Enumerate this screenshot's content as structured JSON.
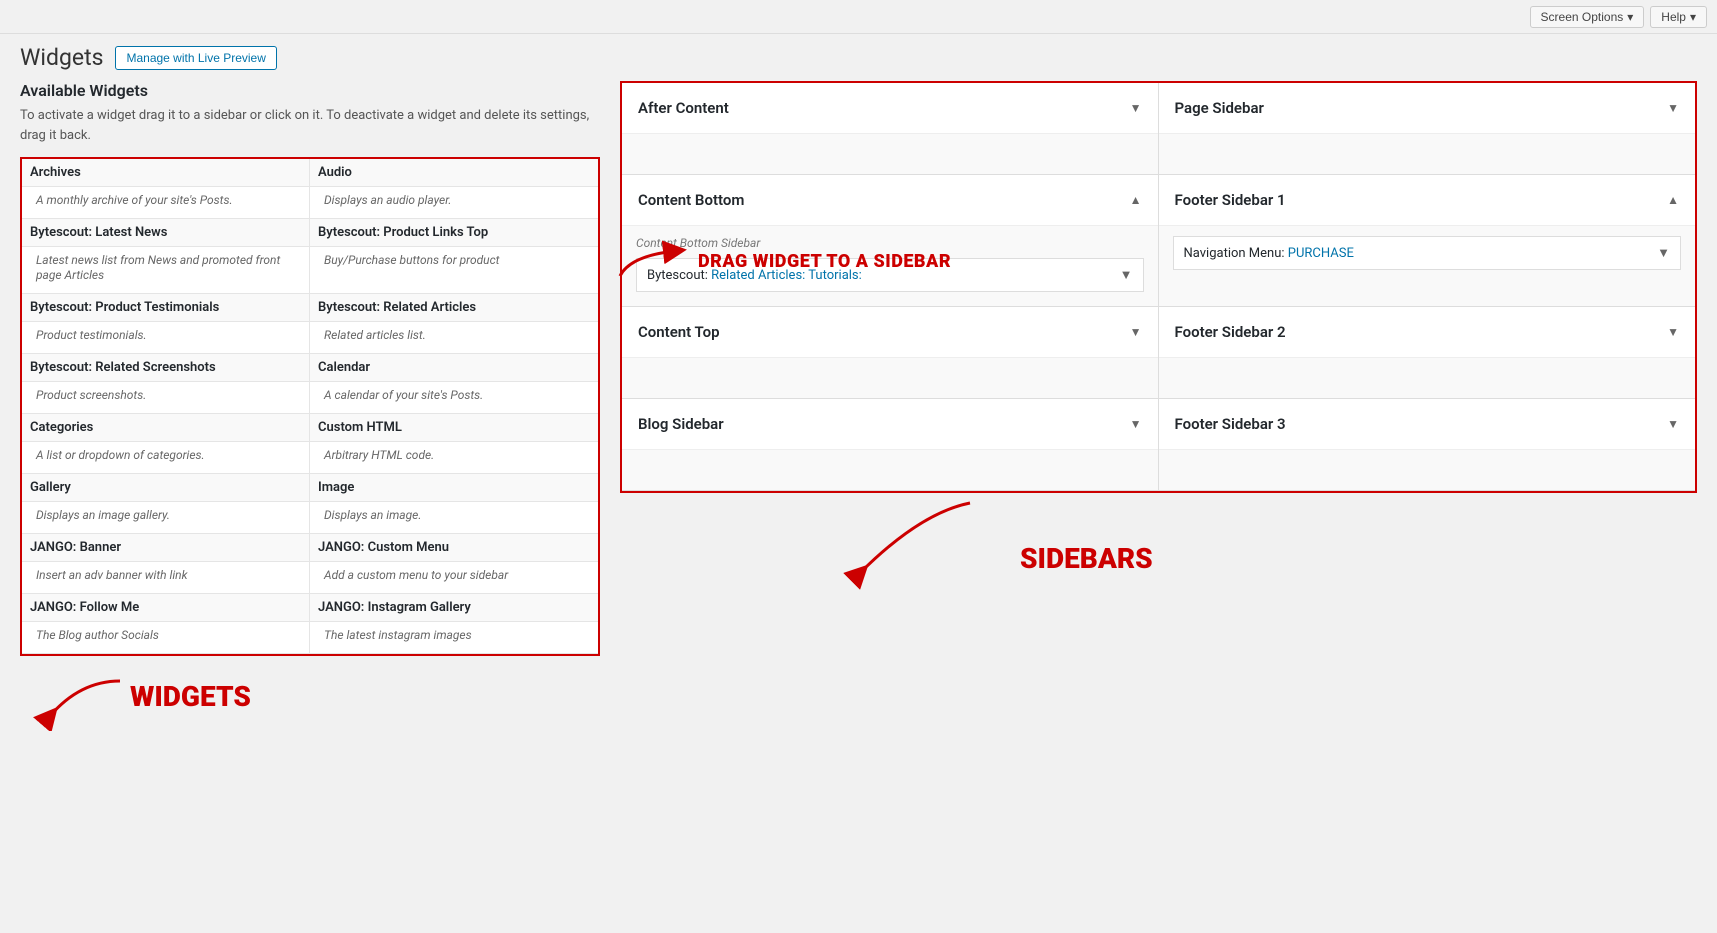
{
  "topbar": {
    "screen_options_label": "Screen Options",
    "help_label": "Help"
  },
  "header": {
    "title": "Widgets",
    "live_preview_label": "Manage with Live Preview"
  },
  "available_widgets": {
    "title": "Available Widgets",
    "description": "To activate a widget drag it to a sidebar or click on it. To deactivate a widget and delete its settings, drag it back."
  },
  "widgets": [
    {
      "name": "Archives",
      "desc": "A monthly archive of your site's Posts."
    },
    {
      "name": "Audio",
      "desc": "Displays an audio player."
    },
    {
      "name": "Bytescout: Latest News",
      "desc": "Latest news list from News and promoted front page Articles"
    },
    {
      "name": "Bytescout: Product Links Top",
      "desc": "Buy/Purchase buttons for product"
    },
    {
      "name": "Bytescout: Product Testimonials",
      "desc": "Product testimonials."
    },
    {
      "name": "Bytescout: Related Articles",
      "desc": "Related articles list."
    },
    {
      "name": "Bytescout: Related Screenshots",
      "desc": "Product screenshots."
    },
    {
      "name": "Calendar",
      "desc": "A calendar of your site's Posts."
    },
    {
      "name": "Categories",
      "desc": "A list or dropdown of categories."
    },
    {
      "name": "Custom HTML",
      "desc": "Arbitrary HTML code."
    },
    {
      "name": "Gallery",
      "desc": "Displays an image gallery."
    },
    {
      "name": "Image",
      "desc": "Displays an image."
    },
    {
      "name": "JANGO: Banner",
      "desc": "Insert an adv banner with link"
    },
    {
      "name": "JANGO: Custom Menu",
      "desc": "Add a custom menu to your sidebar"
    },
    {
      "name": "JANGO: Follow Me",
      "desc": "The Blog author Socials"
    },
    {
      "name": "JANGO: Instagram Gallery",
      "desc": "The latest instagram images"
    }
  ],
  "sidebars": [
    {
      "name": "After Content",
      "arrow": "▼",
      "subtitle": "",
      "widgets": [],
      "col": 1
    },
    {
      "name": "Page Sidebar",
      "arrow": "▼",
      "subtitle": "",
      "widgets": [],
      "col": 2
    },
    {
      "name": "Content Bottom",
      "arrow": "▲",
      "subtitle": "Content Bottom Sidebar",
      "widgets": [
        {
          "name": "Bytescout: Related Articles: Tutorials:",
          "highlight_start": 24
        }
      ],
      "col": 1
    },
    {
      "name": "Footer Sidebar 1",
      "arrow": "▲",
      "subtitle": "",
      "widgets": [
        {
          "name": "Navigation Menu: PURCHASE",
          "highlight_start": 17
        }
      ],
      "col": 2
    },
    {
      "name": "Content Top",
      "arrow": "▼",
      "subtitle": "",
      "widgets": [],
      "col": 1
    },
    {
      "name": "Footer Sidebar 2",
      "arrow": "▼",
      "subtitle": "",
      "widgets": [],
      "col": 2
    },
    {
      "name": "Blog Sidebar",
      "arrow": "▼",
      "subtitle": "",
      "widgets": [],
      "col": 1
    },
    {
      "name": "Footer Sidebar 3",
      "arrow": "▼",
      "subtitle": "",
      "widgets": [],
      "col": 2
    }
  ],
  "annotations": {
    "drag_label": "DRAG WIDGET TO A SIDEBAR",
    "sidebars_label": "SIDEBARS",
    "widgets_label": "WIDGETS"
  }
}
